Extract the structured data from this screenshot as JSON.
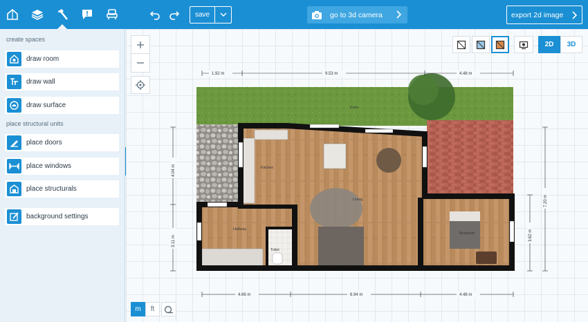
{
  "toolbar": {
    "tabs": [
      {
        "icon": "house-icon"
      },
      {
        "icon": "layers-icon"
      },
      {
        "icon": "hammer-icon",
        "active": true
      },
      {
        "icon": "comment-icon"
      },
      {
        "icon": "armchair-icon"
      }
    ],
    "undo_icon": "undo-icon",
    "redo_icon": "redo-icon",
    "save_label": "save",
    "camera_label": "go to 3d camera",
    "export_label": "export 2d image"
  },
  "sidebar": {
    "create_spaces_title": "create spaces",
    "create_spaces": [
      {
        "label": "draw room",
        "icon": "room-icon"
      },
      {
        "label": "draw wall",
        "icon": "wall-icon"
      },
      {
        "label": "draw surface",
        "icon": "surface-icon"
      }
    ],
    "structural_title": "place structural units",
    "structural": [
      {
        "label": "place doors",
        "icon": "door-icon"
      },
      {
        "label": "place windows",
        "icon": "window-icon"
      },
      {
        "label": "place structurals",
        "icon": "structural-icon"
      }
    ],
    "background_label": "background settings"
  },
  "view": {
    "mode_2d": "2D",
    "mode_3d": "3D",
    "active_mode": "2D"
  },
  "units": {
    "metric": "m",
    "imperial": "ft",
    "active": "m"
  },
  "plan": {
    "dims_top": [
      "1.92 m",
      "9.53 m",
      "4.48 m"
    ],
    "dims_bottom": [
      "4.66 m",
      "6.94 m",
      "4.48 m"
    ],
    "dims_left": [
      "4.04 m",
      "3.11 m"
    ],
    "dims_right": [
      "7.20 m",
      "3.62 m"
    ],
    "rooms": [
      "Patio",
      "Kitchen",
      "Living",
      "Hallway",
      "Toilet",
      "Bedroom"
    ]
  },
  "colors": {
    "accent": "#1b8fd4",
    "grass": "#6f9a44",
    "wood": "#b8895a",
    "brick": "#b5665a",
    "stone": "#9c9a97",
    "wall": "#111111"
  }
}
